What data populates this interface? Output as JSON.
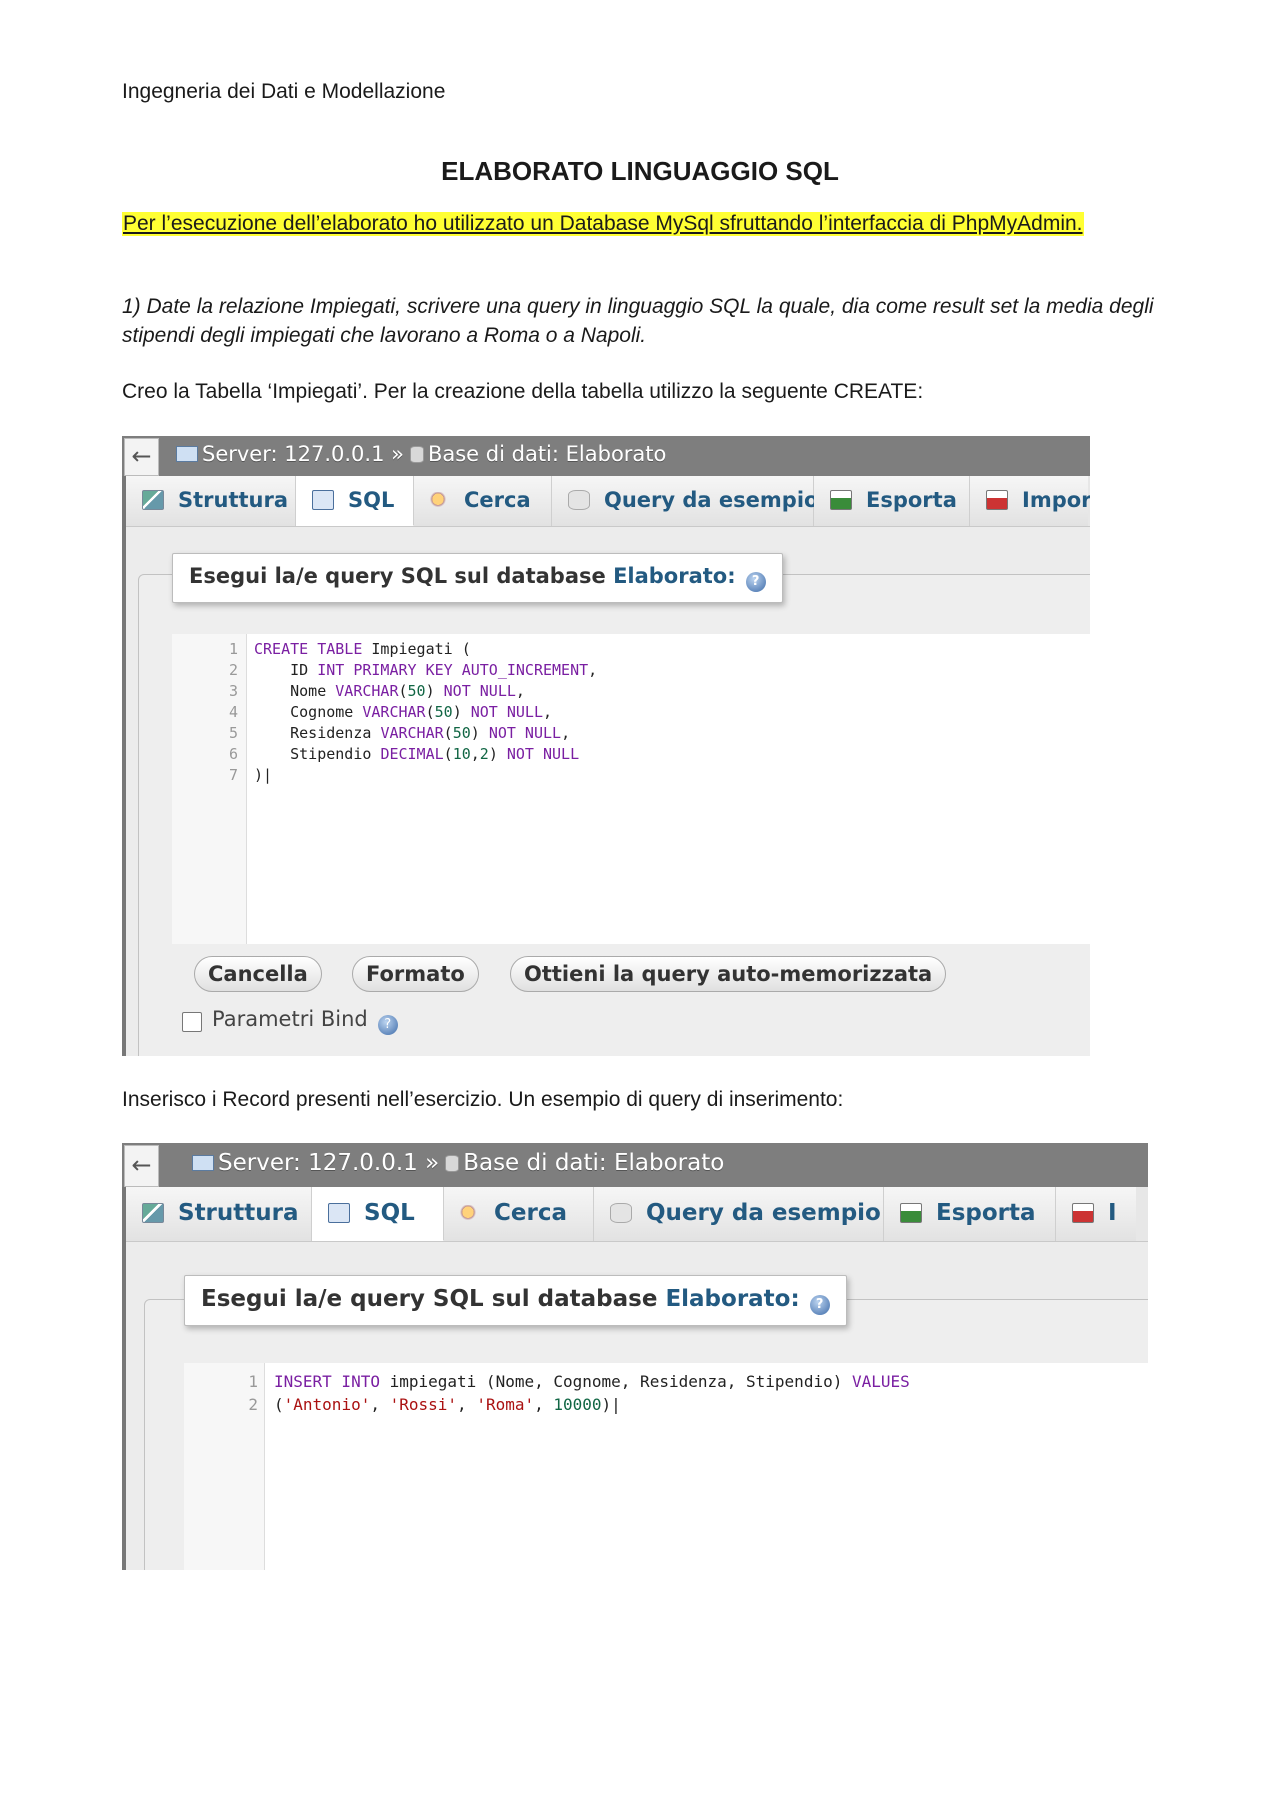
{
  "doc": {
    "header": "Ingegneria dei Dati e Modellazione",
    "title": "ELABORATO LINGUAGGIO SQL",
    "highlight": "Per l’esecuzione dell’elaborato ho utilizzato un Database MySql sfruttando l’interfaccia di PhpMyAdmin.",
    "question": "1)  Date la relazione Impiegati, scrivere una query in linguaggio SQL la quale, dia come result set la media degli stipendi degli impiegati che lavorano a Roma o a Napoli.",
    "para1": "Creo la Tabella ‘Impiegati’. Per la creazione della tabella utilizzo la seguente CREATE:",
    "para2": "Inserisco i Record presenti nell’esercizio. Un esempio di query di inserimento:"
  },
  "shot1": {
    "back": "←",
    "server": "Server: 127.0.0.1 »",
    "database": "Base di dati: Elaborato",
    "tabs": [
      "Struttura",
      "SQL",
      "Cerca",
      "Query da esempio",
      "Esporta",
      "Impor"
    ],
    "legend_text": "Esegui la/e query SQL sul database ",
    "legend_db": "Elaborato:",
    "help": "?",
    "code": [
      {
        "n": "1",
        "t": "CREATE TABLE Impiegati ("
      },
      {
        "n": "2",
        "t": "    ID INT PRIMARY KEY AUTO_INCREMENT,"
      },
      {
        "n": "3",
        "t": "    Nome VARCHAR(50) NOT NULL,"
      },
      {
        "n": "4",
        "t": "    Cognome VARCHAR(50) NOT NULL,"
      },
      {
        "n": "5",
        "t": "    Residenza VARCHAR(50) NOT NULL,"
      },
      {
        "n": "6",
        "t": "    Stipendio DECIMAL(10,2) NOT NULL"
      },
      {
        "n": "7",
        "t": ")"
      }
    ],
    "buttons": [
      "Cancella",
      "Formato",
      "Ottieni la query auto-memorizzata"
    ],
    "bind_label": "Parametri Bind"
  },
  "shot2": {
    "back": "←",
    "server": "Server: 127.0.0.1 »",
    "database": "Base di dati: Elaborato",
    "tabs": [
      "Struttura",
      "SQL",
      "Cerca",
      "Query da esempio",
      "Esporta",
      "I"
    ],
    "legend_text": "Esegui la/e query SQL sul database ",
    "legend_db": "Elaborato:",
    "help": "?",
    "code": [
      {
        "n": "1",
        "t": "INSERT INTO impiegati (Nome, Cognome, Residenza, Stipendio) VALUES"
      },
      {
        "n": "2",
        "t": "('Antonio', 'Rossi', 'Roma', 10000)"
      }
    ]
  }
}
